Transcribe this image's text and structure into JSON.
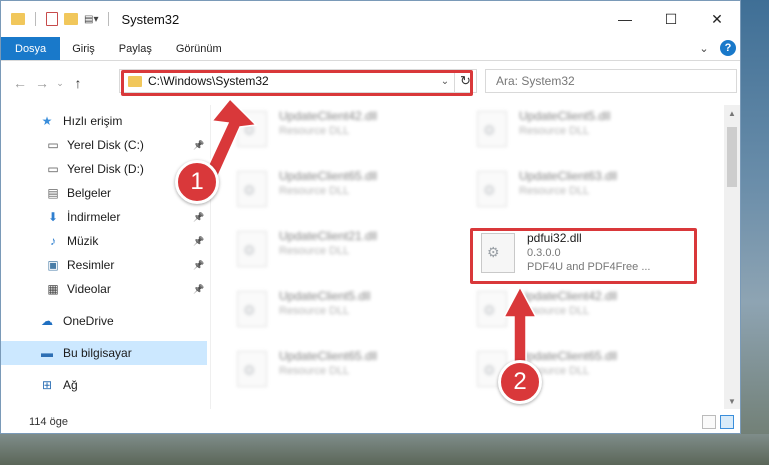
{
  "window": {
    "title": "System32",
    "controls": {
      "minimize": "—",
      "maximize": "☐",
      "close": "✕"
    }
  },
  "ribbon": {
    "tabs": [
      "Dosya",
      "Giriş",
      "Paylaş",
      "Görünüm"
    ],
    "active_tab": "Dosya",
    "expand_glyph": "⌄",
    "help_glyph": "?"
  },
  "address_bar": {
    "path": "C:\\Windows\\System32",
    "search_placeholder": "Ara: System32"
  },
  "nav_pane": {
    "items": [
      {
        "label": "Hızlı erişim",
        "icon": "star-icon",
        "glyph": "★",
        "color": "#3a8edb",
        "pinned": false,
        "top": true
      },
      {
        "label": "Yerel Disk (C:)",
        "icon": "drive-icon",
        "glyph": "▭",
        "color": "#555555",
        "pinned": true
      },
      {
        "label": "Yerel Disk (D:)",
        "icon": "drive-icon",
        "glyph": "▭",
        "color": "#555555",
        "pinned": true
      },
      {
        "label": "Belgeler",
        "icon": "documents-icon",
        "glyph": "▤",
        "color": "#666666",
        "pinned": true
      },
      {
        "label": "İndirmeler",
        "icon": "download-icon",
        "glyph": "⬇",
        "color": "#2f7fd0",
        "pinned": true
      },
      {
        "label": "Müzik",
        "icon": "music-icon",
        "glyph": "♪",
        "color": "#2f7fd0",
        "pinned": true
      },
      {
        "label": "Resimler",
        "icon": "pictures-icon",
        "glyph": "▣",
        "color": "#4a7ea8",
        "pinned": true
      },
      {
        "label": "Videolar",
        "icon": "videos-icon",
        "glyph": "▦",
        "color": "#444444",
        "pinned": true
      },
      {
        "label": "OneDrive",
        "icon": "cloud-icon",
        "glyph": "☁",
        "color": "#1f6fc1",
        "pinned": false,
        "top": true
      },
      {
        "label": "Bu bilgisayar",
        "icon": "computer-icon",
        "glyph": "▬",
        "color": "#2d6fb4",
        "pinned": false,
        "top": true,
        "selected": true
      },
      {
        "label": "Ağ",
        "icon": "network-icon",
        "glyph": "⊞",
        "color": "#2d6fb4",
        "pinned": false,
        "top": true
      }
    ]
  },
  "files": [
    {
      "name": "UpdateClient42.dll",
      "desc": "Resource DLL",
      "col": 0,
      "row": 0
    },
    {
      "name": "UpdateClient5.dll",
      "desc": "Resource DLL",
      "col": 1,
      "row": 0
    },
    {
      "name": "UpdateClient65.dll",
      "desc": "Resource DLL",
      "col": 0,
      "row": 1
    },
    {
      "name": "UpdateClient63.dll",
      "desc": "Resource DLL",
      "col": 1,
      "row": 1
    },
    {
      "name": "UpdateClient21.dll",
      "desc": "Resource DLL",
      "col": 0,
      "row": 2
    },
    {
      "name": "UpdateClient5.dll",
      "desc": "Resource DLL",
      "col": 0,
      "row": 3
    },
    {
      "name": "UpdateClient42.dll",
      "desc": "Resource DLL",
      "col": 1,
      "row": 3
    },
    {
      "name": "UpdateClient65.dll",
      "desc": "Resource DLL",
      "col": 0,
      "row": 4
    },
    {
      "name": "UpdateClient65.dll",
      "desc": "Resource DLL",
      "col": 1,
      "row": 4
    }
  ],
  "target_file": {
    "name": "pdfui32.dll",
    "version": "0.3.0.0",
    "desc": "PDF4U and PDF4Free ..."
  },
  "status": {
    "item_count": "114 öge"
  },
  "callouts": [
    {
      "number": "1"
    },
    {
      "number": "2"
    }
  ],
  "colors": {
    "accent": "#1979ca",
    "highlight": "#d9383a",
    "selected": "#cce8ff"
  }
}
